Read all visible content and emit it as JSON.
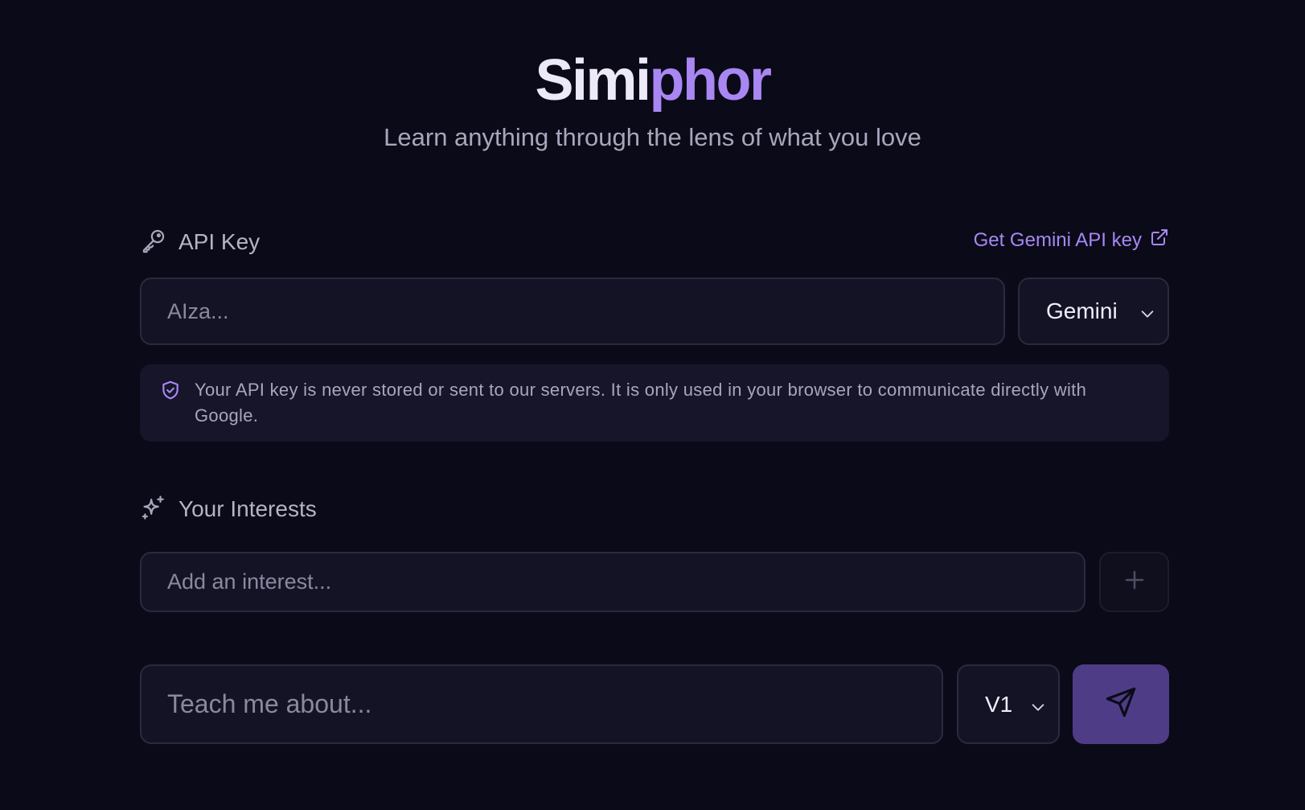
{
  "header": {
    "logo_part1": "Simi",
    "logo_part2": "phor",
    "tagline": "Learn anything through the lens of what you love"
  },
  "api_key": {
    "label": "API Key",
    "label_icon": "key-icon",
    "get_key_link": "Get Gemini API key",
    "link_icon": "external-link-icon",
    "input_placeholder": "AIza...",
    "input_value": "",
    "provider_selected": "Gemini",
    "notice": "Your API key is never stored or sent to our servers. It is only used in your browser to communicate directly with Google.",
    "notice_icon": "shield-check-icon"
  },
  "interests": {
    "label": "Your Interests",
    "label_icon": "sparkles-icon",
    "input_placeholder": "Add an interest...",
    "input_value": "",
    "add_icon": "plus-icon"
  },
  "prompt": {
    "input_placeholder": "Teach me about...",
    "input_value": "",
    "version_selected": "V1",
    "send_icon": "send-icon"
  },
  "colors": {
    "background": "#0b0a18",
    "accent": "#a887f3",
    "send_button": "#4f3c86",
    "field_bg": "#141326",
    "field_border": "#2b293f"
  }
}
